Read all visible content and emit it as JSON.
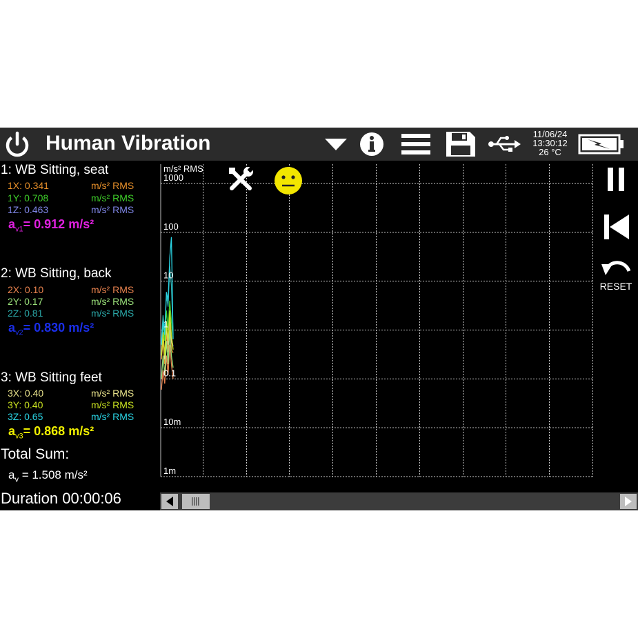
{
  "header": {
    "title": "Human Vibration",
    "date": "11/06/24",
    "time": "13:30:12",
    "temperature": "26 °C",
    "icons": [
      "power-icon",
      "dropdown-icon",
      "info-icon",
      "menu-icon",
      "save-icon",
      "usb-icon",
      "battery-charging-icon"
    ]
  },
  "groups": [
    {
      "title": "1: WB Sitting, seat",
      "rows": [
        {
          "label": "1X: 0.341",
          "unit": "m/s² RMS",
          "color": "#e8902a"
        },
        {
          "label": "1Y: 0.708",
          "unit": "m/s² RMS",
          "color": "#3fcf2a"
        },
        {
          "label": "1Z: 0.463",
          "unit": "m/s² RMS",
          "color": "#7f86e6"
        }
      ],
      "av_prefix": "a",
      "av_sub": "v1",
      "av_value": "= 0.912 m/s²",
      "av_color": "#e020e0"
    },
    {
      "title": "2: WB Sitting, back",
      "rows": [
        {
          "label": "2X: 0.10",
          "unit": "m/s² RMS",
          "color": "#e8824e"
        },
        {
          "label": "2Y: 0.17",
          "unit": "m/s² RMS",
          "color": "#9ae07a"
        },
        {
          "label": "2Z: 0.81",
          "unit": "m/s² RMS",
          "color": "#2aa6a6"
        }
      ],
      "av_prefix": "a",
      "av_sub": "v2",
      "av_value": "= 0.830 m/s²",
      "av_color": "#1a2ee8"
    },
    {
      "title": "3: WB Sitting feet",
      "rows": [
        {
          "label": "3X: 0.40",
          "unit": "m/s² RMS",
          "color": "#e6e08a"
        },
        {
          "label": "3Y: 0.40",
          "unit": "m/s² RMS",
          "color": "#c8e020"
        },
        {
          "label": "3Z: 0.65",
          "unit": "m/s² RMS",
          "color": "#2ad4e4"
        }
      ],
      "av_prefix": "a",
      "av_sub": "v3",
      "av_value": "= 0.868 m/s²",
      "av_color": "#f0f000"
    }
  ],
  "total": {
    "title": "Total Sum:",
    "av_prefix": "a",
    "av_sub": "v",
    "av_value": " = 1.508 m/s²"
  },
  "duration": "Duration 00:00:06",
  "controls": {
    "reset_label": "RESET",
    "icons": [
      "tools-icon",
      "neutral-face-icon",
      "pause-icon",
      "skip-to-start-icon",
      "undo-icon"
    ]
  },
  "chart_data": {
    "type": "line",
    "ylabel": "m/s² RMS",
    "yscale": "log",
    "ylim": [
      0.001,
      1000
    ],
    "y_ticks": [
      {
        "value": 1000,
        "label": "1000"
      },
      {
        "value": 100,
        "label": "100"
      },
      {
        "value": 10,
        "label": "10"
      },
      {
        "value": 1,
        "label": "1"
      },
      {
        "value": 0.1,
        "label": "0.1"
      },
      {
        "value": 0.01,
        "label": "10m"
      },
      {
        "value": 0.001,
        "label": "1m"
      }
    ],
    "x_range_seconds": [
      0,
      100
    ],
    "x_gridlines": 10,
    "grid": true,
    "series": [
      {
        "color": "#e8902a",
        "values": [
          0.25,
          0.6,
          0.2,
          0.9,
          0.35,
          1.5,
          0.4,
          0.341
        ]
      },
      {
        "color": "#3fcf2a",
        "values": [
          0.5,
          1.4,
          0.6,
          2.5,
          1.0,
          4.0,
          1.5,
          0.708
        ]
      },
      {
        "color": "#7f86e6",
        "values": [
          0.35,
          0.9,
          0.3,
          1.2,
          0.5,
          2.0,
          0.7,
          0.463
        ]
      },
      {
        "color": "#e8824e",
        "values": [
          0.06,
          0.15,
          0.08,
          0.3,
          0.12,
          0.5,
          0.2,
          0.1
        ]
      },
      {
        "color": "#9ae07a",
        "values": [
          0.1,
          0.3,
          0.12,
          0.6,
          0.2,
          1.0,
          0.3,
          0.17
        ]
      },
      {
        "color": "#2aa6a6",
        "values": [
          0.6,
          2.0,
          1.0,
          5.0,
          3.0,
          20.0,
          8.0,
          0.81
        ]
      },
      {
        "color": "#e6e08a",
        "values": [
          0.3,
          0.8,
          0.25,
          1.2,
          0.5,
          2.2,
          0.6,
          0.4
        ]
      },
      {
        "color": "#c8e020",
        "values": [
          0.3,
          0.9,
          0.3,
          1.5,
          0.6,
          2.5,
          0.8,
          0.4
        ]
      },
      {
        "color": "#2ad4e4",
        "values": [
          0.5,
          1.5,
          0.8,
          6.0,
          4.0,
          30.0,
          80.0,
          0.65
        ]
      }
    ]
  }
}
